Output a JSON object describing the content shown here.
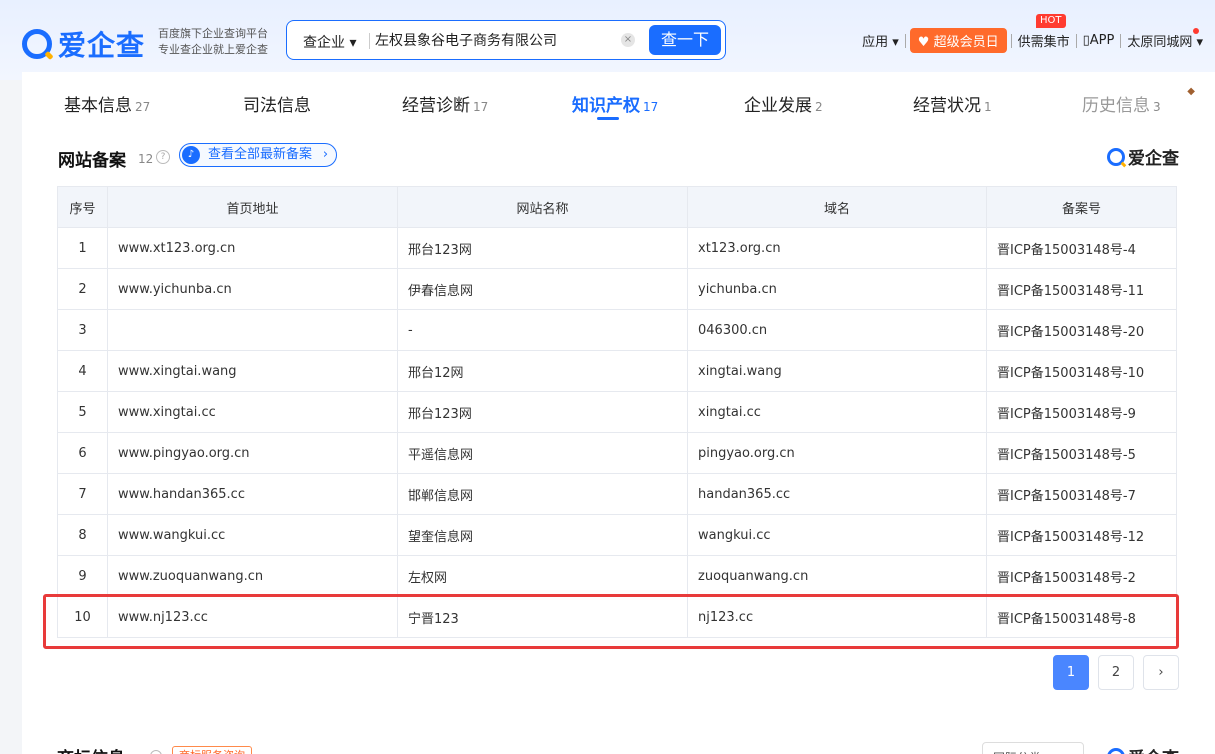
{
  "header": {
    "logo_text": "爱企查",
    "tagline_line1": "百度旗下企业查询平台",
    "tagline_line2": "专业查企业就上爱企查",
    "search": {
      "type_label": "查企业 ▾",
      "value": "左权县象谷电子商务有限公司",
      "clear": "×",
      "button": "查一下"
    },
    "nav": {
      "apps": "应用 ▾",
      "vip": "超级会员日",
      "hot": "HOT",
      "supply": "供需集市",
      "app": "APP",
      "city": "太原同城网 ▾"
    }
  },
  "tabs": [
    {
      "label": "基本信息",
      "count": "27"
    },
    {
      "label": "司法信息",
      "count": ""
    },
    {
      "label": "经营诊断",
      "count": "17"
    },
    {
      "label": "知识产权",
      "count": "17"
    },
    {
      "label": "企业发展",
      "count": "2"
    },
    {
      "label": "经营状况",
      "count": "1"
    },
    {
      "label": "历史信息",
      "count": "3"
    }
  ],
  "section": {
    "title": "网站备案",
    "count": "12",
    "help": "?",
    "notice": "查看全部最新备案",
    "brand": "爱企查"
  },
  "table": {
    "headers": [
      "序号",
      "首页地址",
      "网站名称",
      "域名",
      "备案号"
    ],
    "rows": [
      [
        "1",
        "www.xt123.org.cn",
        "邢台123网",
        "xt123.org.cn",
        "晋ICP备15003148号-4"
      ],
      [
        "2",
        "www.yichunba.cn",
        "伊春信息网",
        "yichunba.cn",
        "晋ICP备15003148号-11"
      ],
      [
        "3",
        "",
        "-",
        "046300.cn",
        "晋ICP备15003148号-20"
      ],
      [
        "4",
        "www.xingtai.wang",
        "邢台12网",
        "xingtai.wang",
        "晋ICP备15003148号-10"
      ],
      [
        "5",
        "www.xingtai.cc",
        "邢台123网",
        "xingtai.cc",
        "晋ICP备15003148号-9"
      ],
      [
        "6",
        "www.pingyao.org.cn",
        "平遥信息网",
        "pingyao.org.cn",
        "晋ICP备15003148号-5"
      ],
      [
        "7",
        "www.handan365.cc",
        "邯郸信息网",
        "handan365.cc",
        "晋ICP备15003148号-7"
      ],
      [
        "8",
        "www.wangkui.cc",
        "望奎信息网",
        "wangkui.cc",
        "晋ICP备15003148号-12"
      ],
      [
        "9",
        "www.zuoquanwang.cn",
        "左权网",
        "zuoquanwang.cn",
        "晋ICP备15003148号-2"
      ],
      [
        "10",
        "www.nj123.cc",
        "宁晋123",
        "nj123.cc",
        "晋ICP备15003148号-8"
      ]
    ]
  },
  "pager": {
    "pages": [
      "1",
      "2"
    ],
    "next": "›",
    "current": "1"
  },
  "next_section": {
    "title": "商标信息",
    "tag": "商标服务咨询",
    "select": "国际分类",
    "brand": "爱企查"
  },
  "colors": {
    "accent": "#1a6dff",
    "highlight": "#e83a3a",
    "vip": "#ff6a2b"
  }
}
